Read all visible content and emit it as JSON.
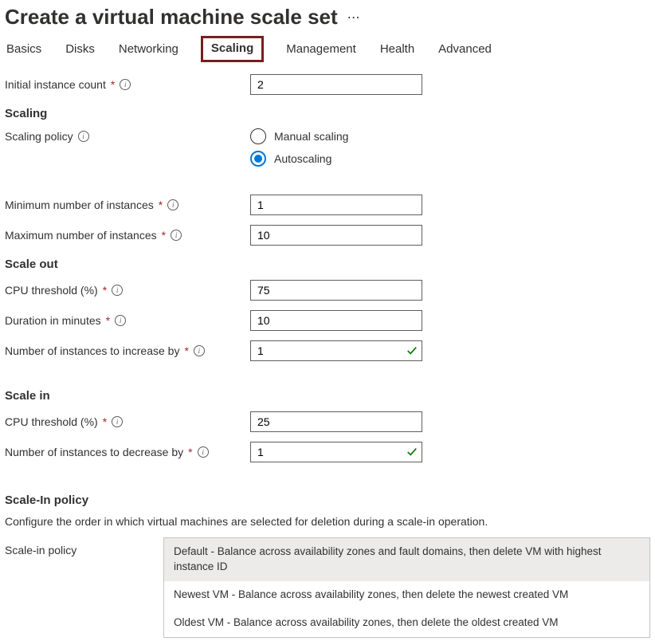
{
  "title": "Create a virtual machine scale set",
  "tabs": [
    {
      "label": "Basics"
    },
    {
      "label": "Disks"
    },
    {
      "label": "Networking"
    },
    {
      "label": "Scaling"
    },
    {
      "label": "Management"
    },
    {
      "label": "Health"
    },
    {
      "label": "Advanced"
    }
  ],
  "initial": {
    "label": "Initial instance count",
    "value": "2"
  },
  "scaling_section": "Scaling",
  "scaling_policy": {
    "label": "Scaling policy",
    "manual": "Manual scaling",
    "auto": "Autoscaling"
  },
  "min": {
    "label": "Minimum number of instances",
    "value": "1"
  },
  "max": {
    "label": "Maximum number of instances",
    "value": "10"
  },
  "scale_out_section": "Scale out",
  "out_cpu": {
    "label": "CPU threshold (%)",
    "value": "75"
  },
  "out_dur": {
    "label": "Duration in minutes",
    "value": "10"
  },
  "out_inc": {
    "label": "Number of instances to increase by",
    "value": "1"
  },
  "scale_in_section": "Scale in",
  "in_cpu": {
    "label": "CPU threshold (%)",
    "value": "25"
  },
  "in_dec": {
    "label": "Number of instances to decrease by",
    "value": "1"
  },
  "policy_section": "Scale-In policy",
  "policy_desc": "Configure the order in which virtual machines are selected for deletion during a scale-in operation.",
  "policy_label": "Scale-in policy",
  "policy_options": [
    "Default - Balance across availability zones and fault domains, then delete VM with highest instance ID",
    "Newest VM - Balance across availability zones, then delete the newest created VM",
    "Oldest VM - Balance across availability zones, then delete the oldest created VM"
  ]
}
